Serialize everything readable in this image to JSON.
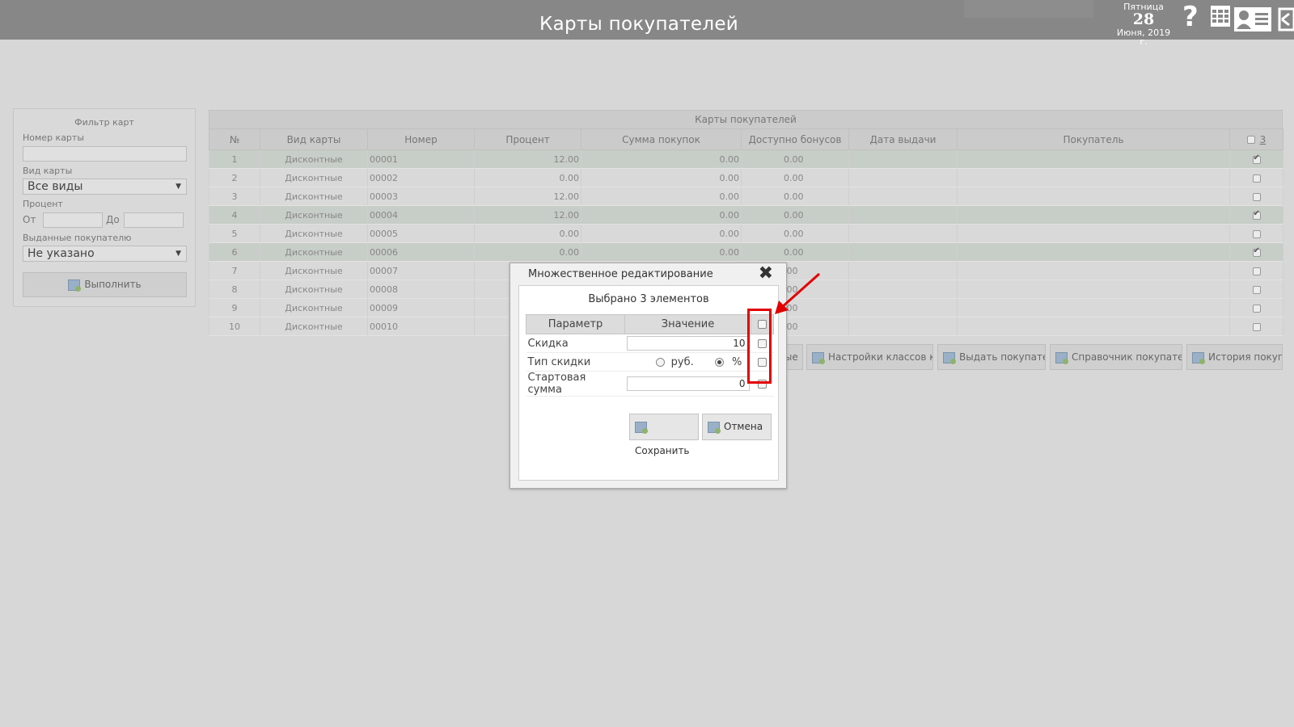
{
  "header": {
    "title": "Карты покупателей",
    "date": {
      "weekday": "Пятница",
      "day": "28",
      "month_year": "Июня, 2019 г."
    },
    "icons": [
      "help-icon",
      "grid-icon",
      "user-card-icon",
      "exit-icon"
    ]
  },
  "filter": {
    "title": "Фильтр карт",
    "card_number_label": "Номер карты",
    "card_number_value": "",
    "card_type_label": "Вид карты",
    "card_type_value": "Все виды",
    "percent_label": "Процент",
    "from_label": "От",
    "to_label": "До",
    "issued_label": "Выданные покупателю",
    "issued_value": "Не указано",
    "run_label": "Выполнить"
  },
  "table": {
    "caption": "Карты покупателей",
    "columns": [
      "№",
      "Вид карты",
      "Номер",
      "Процент",
      "Сумма покупок",
      "Доступно бонусов",
      "Дата выдачи",
      "Покупатель"
    ],
    "selected_count": "3",
    "rows": [
      {
        "n": "1",
        "type": "Дисконтные",
        "number": "00001",
        "percent": "12.00",
        "sum": "0.00",
        "bonus": "0.00",
        "date": "",
        "buyer": "",
        "checked": true
      },
      {
        "n": "2",
        "type": "Дисконтные",
        "number": "00002",
        "percent": "0.00",
        "sum": "0.00",
        "bonus": "0.00",
        "date": "",
        "buyer": "",
        "checked": false
      },
      {
        "n": "3",
        "type": "Дисконтные",
        "number": "00003",
        "percent": "12.00",
        "sum": "0.00",
        "bonus": "0.00",
        "date": "",
        "buyer": "",
        "checked": false
      },
      {
        "n": "4",
        "type": "Дисконтные",
        "number": "00004",
        "percent": "12.00",
        "sum": "0.00",
        "bonus": "0.00",
        "date": "",
        "buyer": "",
        "checked": true
      },
      {
        "n": "5",
        "type": "Дисконтные",
        "number": "00005",
        "percent": "0.00",
        "sum": "0.00",
        "bonus": "0.00",
        "date": "",
        "buyer": "",
        "checked": false
      },
      {
        "n": "6",
        "type": "Дисконтные",
        "number": "00006",
        "percent": "0.00",
        "sum": "0.00",
        "bonus": "0.00",
        "date": "",
        "buyer": "",
        "checked": true
      },
      {
        "n": "7",
        "type": "Дисконтные",
        "number": "00007",
        "percent": "",
        "sum": "",
        "bonus": ".00",
        "date": "",
        "buyer": "",
        "checked": false
      },
      {
        "n": "8",
        "type": "Дисконтные",
        "number": "00008",
        "percent": "",
        "sum": "",
        "bonus": ".00",
        "date": "",
        "buyer": "",
        "checked": false
      },
      {
        "n": "9",
        "type": "Дисконтные",
        "number": "00009",
        "percent": "",
        "sum": "",
        "bonus": ".00",
        "date": "",
        "buyer": "",
        "checked": false
      },
      {
        "n": "10",
        "type": "Дисконтные",
        "number": "00010",
        "percent": "",
        "sum": "",
        "bonus": ".00",
        "date": "",
        "buyer": "",
        "checked": false
      }
    ]
  },
  "toolbar": {
    "partial_label": "ные",
    "class_settings": "Настройки классов карт",
    "issue_to_buyer": "Выдать покупателю",
    "buyers_directory": "Справочник покупателей",
    "purchase_history": "История покупок"
  },
  "dialog": {
    "title": "Множественное редактирование",
    "selected_text": "Выбрано 3 элементов",
    "col_param": "Параметр",
    "col_value": "Значение",
    "discount_label": "Скидка",
    "discount_value": "10",
    "discount_type_label": "Тип скидки",
    "rub_label": "руб.",
    "percent_label": "%",
    "discount_type_selected": "%",
    "start_sum_label": "Стартовая сумма",
    "start_sum_value": "0",
    "save_label": "Сохранить",
    "cancel_label": "Отмена"
  },
  "colors": {
    "highlight": "#e30000",
    "header_bg": "#878787"
  }
}
